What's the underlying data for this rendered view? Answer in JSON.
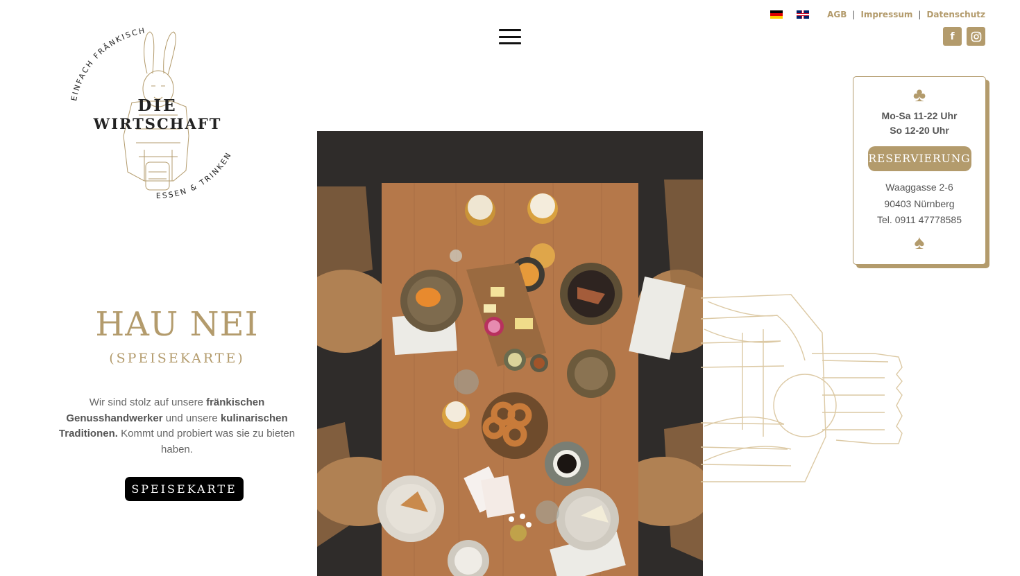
{
  "top_links": {
    "lang_de": "Deutsch",
    "lang_en": "English",
    "agb": "AGB",
    "impressum": "Impressum",
    "datenschutz": "Datenschutz",
    "separator": "|"
  },
  "social": {
    "facebook_icon": "facebook-icon",
    "instagram_icon": "instagram-icon",
    "facebook_glyph": "f",
    "instagram_glyph": "◎"
  },
  "logo": {
    "arc_top": "EINFACH FRÄNKISCH",
    "line1": "DIE",
    "line2": "WIRTSCHAFT",
    "arc_bottom": "ESSEN & TRINKEN"
  },
  "hero": {
    "title": "HAU NEI",
    "subtitle": "(SPEISEKARTE)",
    "text_1": "Wir sind stolz auf unsere ",
    "text_2": "fränkischen Genusshandwerker",
    "text_3": " und unsere ",
    "text_4": "kulinarischen Traditionen.",
    "text_5": " Kommt und probiert was sie zu bieten haben.",
    "button": "SPEISEKARTE"
  },
  "info_card": {
    "top_suit": "♣",
    "hours_1": "Mo-Sa 11-22 Uhr",
    "hours_2": "So 12-20 Uhr",
    "reservation_button": "RESERVIERUNG",
    "street": "Waaggasse 2-6",
    "city": "90403 Nürnberg",
    "phone": "Tel. 0911 47778585",
    "bottom_suit": "♠"
  },
  "colors": {
    "gold": "#b39b6c",
    "black": "#000000",
    "text": "#555555"
  }
}
